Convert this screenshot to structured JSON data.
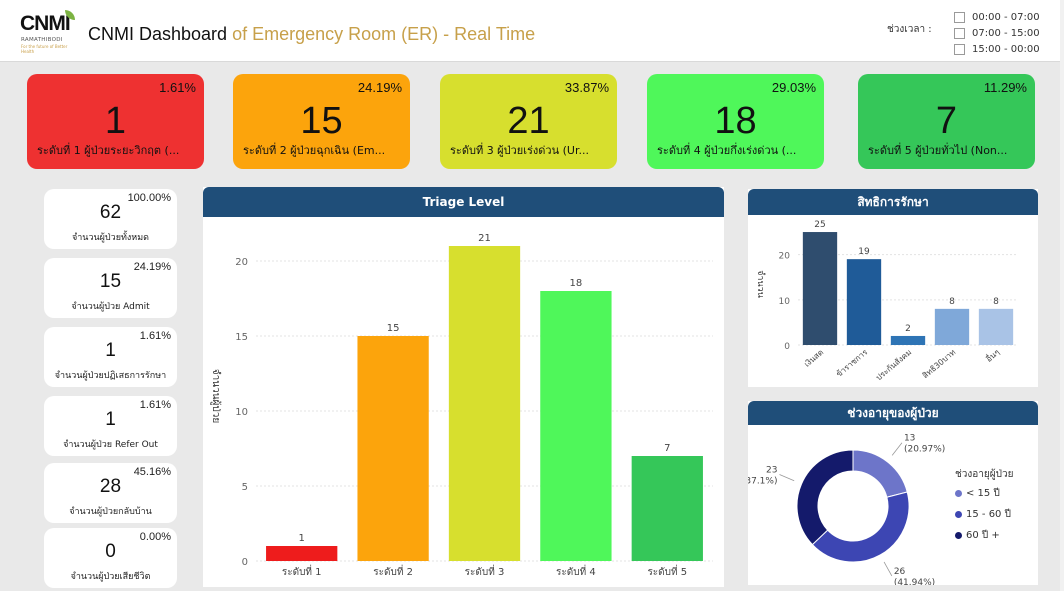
{
  "header": {
    "logo_text": "CNMI",
    "logo_sub": "RAMATHIBODI",
    "logo_tagline": "For the future of Better Health",
    "title_part1": "CNMI Dashboard",
    "title_part2": " of Emergency Room (ER) - Real Time",
    "time_label": "ช่วงเวลา :",
    "time_options": [
      "00:00 - 07:00",
      "07:00 - 15:00",
      "15:00 - 00:00"
    ]
  },
  "kpis": [
    {
      "value": "1",
      "pct": "1.61%",
      "label": "ระดับที่ 1 ผู้ป่วยระยะวิกฤต (...",
      "color": "#ee3131"
    },
    {
      "value": "15",
      "pct": "24.19%",
      "label": "ระดับที่ 2 ผู้ป่วยฉุกเฉิน (Em...",
      "color": "#fca40c"
    },
    {
      "value": "21",
      "pct": "33.87%",
      "label": "ระดับที่ 3 ผู้ป่วยเร่งด่วน (Ur...",
      "color": "#d7df2e"
    },
    {
      "value": "18",
      "pct": "29.03%",
      "label": "ระดับที่ 4 ผู้ป่วยกึ่งเร่งด่วน (...",
      "color": "#4ff75a"
    },
    {
      "value": "7",
      "pct": "11.29%",
      "label": "ระดับที่ 5 ผู้ป่วยทั่วไป (Non...",
      "color": "#35c759"
    }
  ],
  "side_cards": [
    {
      "value": "62",
      "pct": "100.00%",
      "label": "จำนวนผู้ป่วยทั้งหมด"
    },
    {
      "value": "15",
      "pct": "24.19%",
      "label": "จำนวนผู้ป่วย Admit"
    },
    {
      "value": "1",
      "pct": "1.61%",
      "label": "จำนวนผู้ป่วยปฏิเสธการรักษา"
    },
    {
      "value": "1",
      "pct": "1.61%",
      "label": "จำนวนผู้ป่วย Refer Out"
    },
    {
      "value": "28",
      "pct": "45.16%",
      "label": "จำนวนผู้ป่วยกลับบ้าน"
    },
    {
      "value": "0",
      "pct": "0.00%",
      "label": "จำนวนผู้ป่วยเสียชีวิต"
    }
  ],
  "chart_data": [
    {
      "type": "bar",
      "title": "Triage Level",
      "xlabel": "",
      "ylabel": "จำนวนผู้ป่วย",
      "categories": [
        "ระดับที่ 1",
        "ระดับที่ 2",
        "ระดับที่ 3",
        "ระดับที่ 4",
        "ระดับที่ 5"
      ],
      "values": [
        1,
        15,
        21,
        18,
        7
      ],
      "colors": [
        "#ee1c1c",
        "#fca40c",
        "#d7df2e",
        "#4ff75a",
        "#35c759"
      ],
      "ylim": [
        0,
        22
      ],
      "yticks": [
        0,
        5,
        10,
        15,
        20
      ],
      "grid": true
    },
    {
      "type": "bar",
      "title": "สิทธิการรักษา",
      "xlabel": "",
      "ylabel": "จำนวน",
      "categories": [
        "เงินสด",
        "ข้าราชการ",
        "ประกันสังคม",
        "สิทธิ30บาท",
        "อื่นๆ"
      ],
      "values": [
        25,
        19,
        2,
        8,
        8
      ],
      "colors": [
        "#2f4d6e",
        "#1f5b98",
        "#2e74b5",
        "#7fa8d9",
        "#a9c3e6"
      ],
      "ylim": [
        0,
        27
      ],
      "yticks": [
        0,
        10,
        20
      ],
      "grid": true
    },
    {
      "type": "pie",
      "title": "ช่วงอายุของผู้ป่วย",
      "legend_title": "ช่วงอายุผู้ป่วย",
      "legend_position": "right",
      "categories": [
        "< 15 ปี",
        "15 - 60 ปี",
        "60 ปี +"
      ],
      "values": [
        13,
        26,
        23
      ],
      "percents": [
        "(20.97%)",
        "(41.94%)",
        "(37.1%)"
      ],
      "colors": [
        "#6d75c9",
        "#3d46b3",
        "#141a6b"
      ]
    }
  ]
}
